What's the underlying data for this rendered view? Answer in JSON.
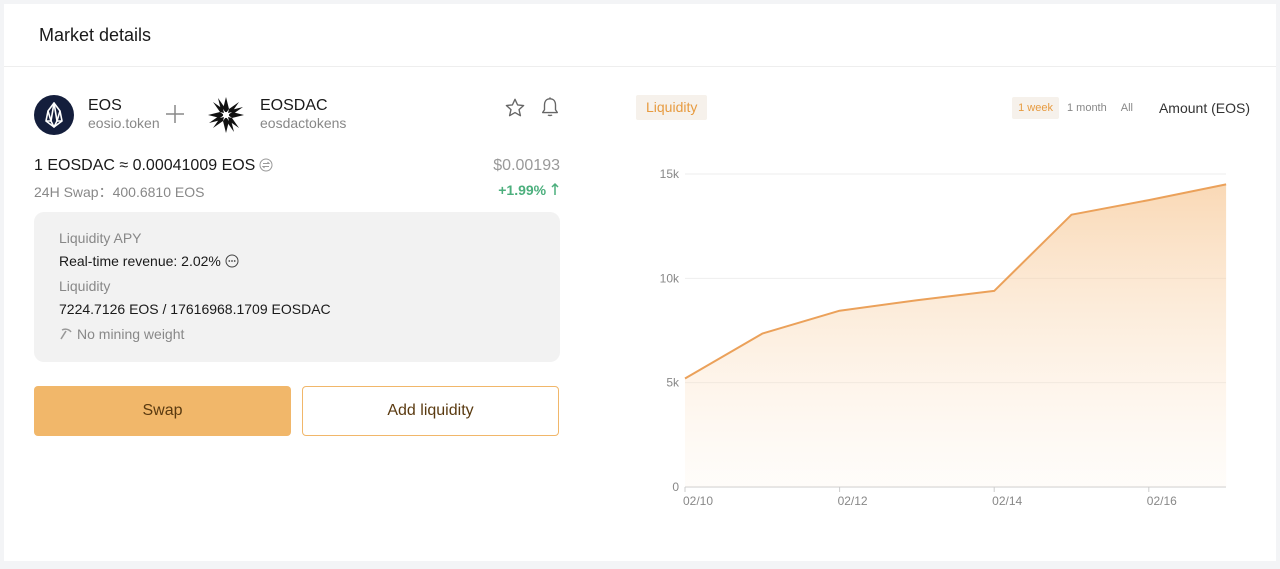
{
  "header": {
    "title": "Market details"
  },
  "pair": {
    "base": {
      "symbol": "EOS",
      "contract": "eosio.token"
    },
    "quote": {
      "symbol": "EOSDAC",
      "contract": "eosdactokens"
    },
    "icons": {
      "plus": "plus-icon",
      "favorite": "star-icon",
      "alert": "bell-icon"
    }
  },
  "price": {
    "rate": "1 EOSDAC ≈ 0.00041009 EOS",
    "usd": "$0.00193",
    "swap24h": "24H Swap：400.6810 EOS",
    "change": "+1.99%",
    "change_color": "#4caf7d"
  },
  "info": {
    "apy_label": "Liquidity APY",
    "revenue": "Real-time revenue: 2.02%",
    "liquidity_label": "Liquidity",
    "liquidity_value": "7224.7126 EOS / 17616968.1709 EOSDAC",
    "mining": "No mining weight"
  },
  "actions": {
    "swap": "Swap",
    "add_liquidity": "Add liquidity"
  },
  "chart_controls": {
    "metric_tab": "Liquidity",
    "ranges": [
      "1 week",
      "1 month",
      "All"
    ],
    "active_range": "1 week",
    "unit_select": "Amount (EOS)"
  },
  "colors": {
    "accent": "#f1b76a",
    "accent_text": "#e79b40",
    "line": "#eba15a"
  },
  "chart_data": {
    "type": "area",
    "x": [
      "02/10",
      "02/11",
      "02/12",
      "02/13",
      "02/14",
      "02/15",
      "02/16",
      "02/17"
    ],
    "x_labels": [
      "02/10",
      "02/12",
      "02/14",
      "02/16"
    ],
    "series": [
      {
        "values": [
          5200,
          7350,
          8450,
          8950,
          9400,
          13050,
          13750,
          14500
        ]
      }
    ],
    "y_ticks": [
      "0",
      "5k",
      "10k",
      "15k"
    ],
    "ylim": [
      0,
      15000
    ],
    "grid": true,
    "title": "",
    "xlabel": "",
    "ylabel": ""
  }
}
